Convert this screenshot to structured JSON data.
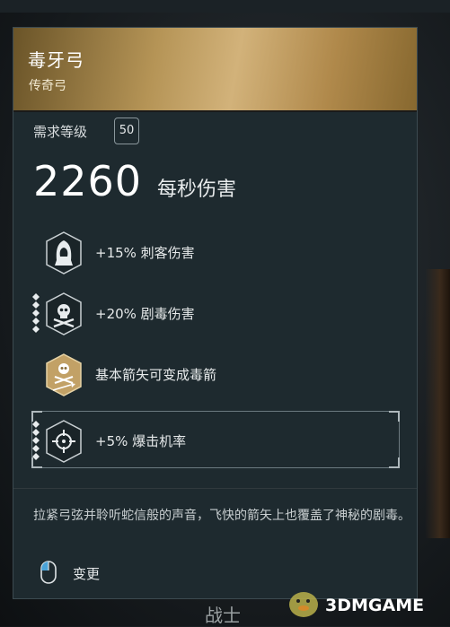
{
  "item": {
    "name": "毒牙弓",
    "rarity": "传奇弓"
  },
  "requirements": {
    "level_label": "需求等级",
    "level_value": "50"
  },
  "stats": {
    "dps_value": "2260",
    "dps_label": "每秒伤害"
  },
  "perks": [
    {
      "label": "+15% 刺客伤害",
      "icon": "hooded-assassin-icon"
    },
    {
      "label": "+20% 剧毒伤害",
      "icon": "skull-crossbones-icon"
    },
    {
      "label": "基本箭矢可变成毒箭",
      "icon": "poison-arrow-icon"
    },
    {
      "label": "+5% 爆击机率",
      "icon": "crosshair-icon"
    }
  ],
  "description": "拉紧弓弦并聆听蛇信般的声音，飞快的箭矢上也覆盖了神秘的剧毒。",
  "actions": {
    "change_label": "变更",
    "change_icon": "mouse-icon"
  },
  "footer": {
    "class_label": "战士",
    "watermark": "3DMGAME"
  },
  "colors": {
    "header_gold": "#c4a266",
    "card_bg": "#1e2a2f",
    "text": "#e8ebec"
  }
}
